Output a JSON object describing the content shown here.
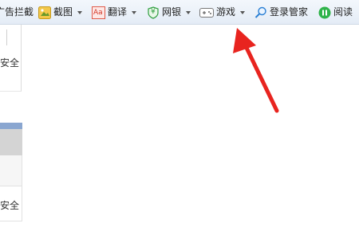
{
  "toolbar": {
    "items": [
      {
        "label": "广告拦截",
        "icon": "adblock-icon",
        "has_caret": false
      },
      {
        "label": "截图",
        "icon": "screenshot-icon",
        "has_caret": true
      },
      {
        "label": "翻译",
        "icon": "translate-icon",
        "icon_text": "Aa",
        "has_caret": true
      },
      {
        "label": "网银",
        "icon": "shield-yuan-icon",
        "icon_text": "¥",
        "has_caret": true
      },
      {
        "label": "游戏",
        "icon": "gamepad-icon",
        "has_caret": true
      },
      {
        "label": "登录管家",
        "icon": "search-key-icon",
        "has_caret": false
      },
      {
        "label": "阅读",
        "icon": "read-mode-icon",
        "has_caret": false
      }
    ]
  },
  "left_panel": {
    "security_text_top": "安全",
    "security_text_bottom": "安全"
  },
  "annotation": {
    "arrow_color": "#e8241f",
    "pointing_to": "游戏"
  }
}
